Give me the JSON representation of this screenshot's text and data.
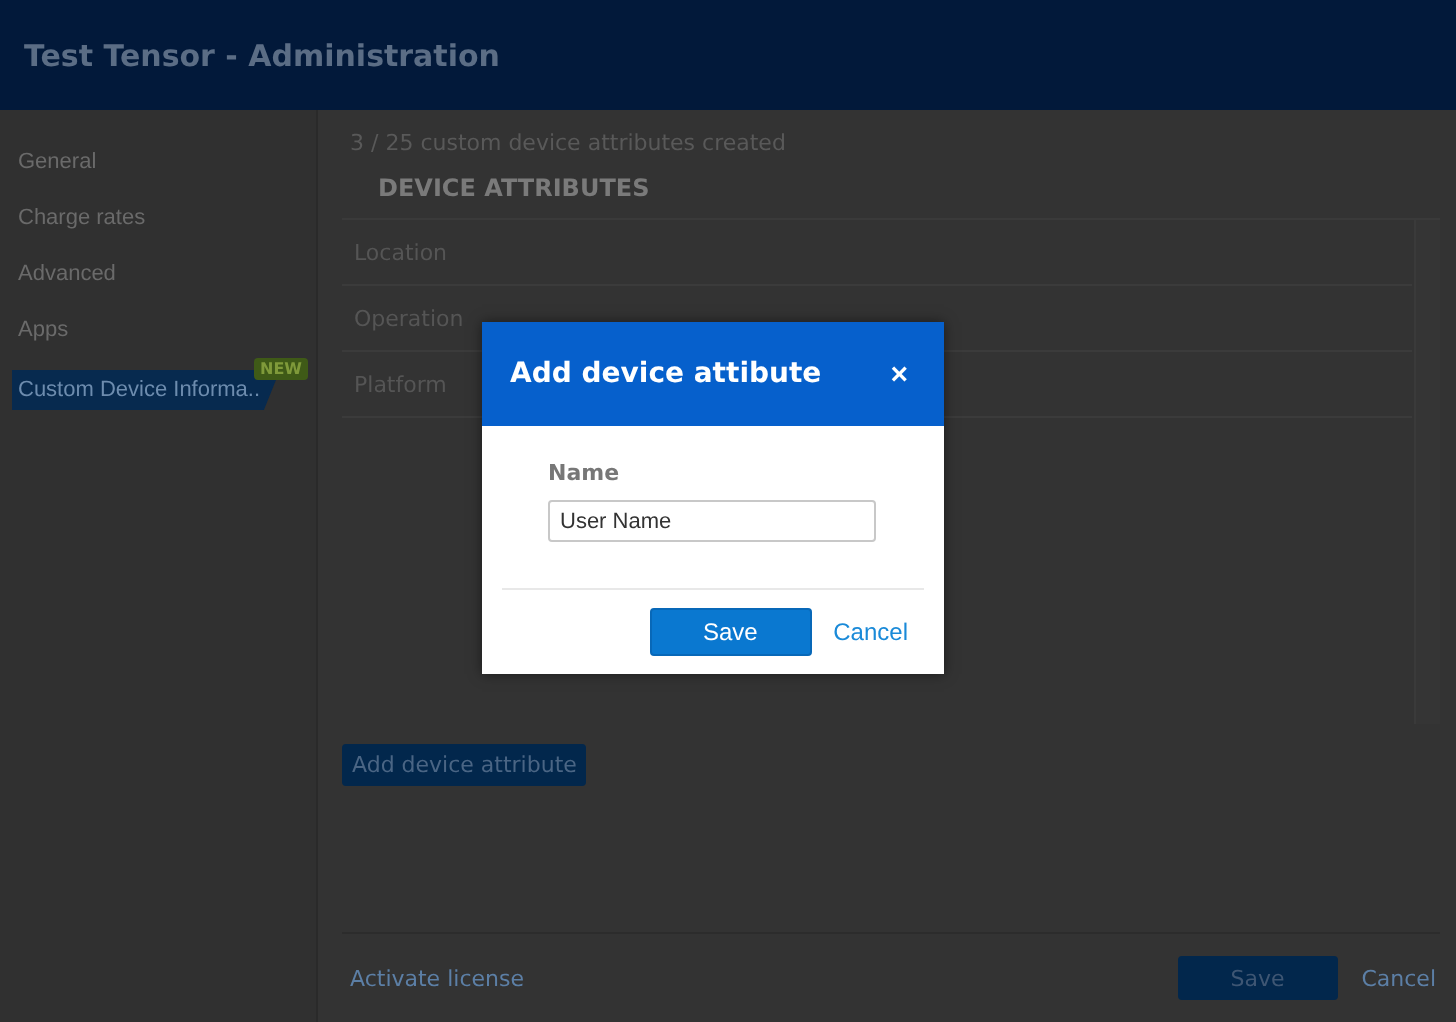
{
  "window": {
    "title": "Test Tensor - Administration"
  },
  "sidebar": {
    "items": [
      {
        "label": "General",
        "selected": false
      },
      {
        "label": "Charge rates",
        "selected": false
      },
      {
        "label": "Advanced",
        "selected": false
      },
      {
        "label": "Apps",
        "selected": false
      },
      {
        "label": "Custom Device Informa..",
        "selected": true,
        "badge": "NEW"
      }
    ]
  },
  "main": {
    "summary": "3 / 25 custom device attributes created",
    "section_title": "DEVICE ATTRIBUTES",
    "attributes": [
      "Location",
      "Operation",
      "Platform"
    ],
    "add_button": "Add device attribute",
    "footer": {
      "link": "Activate license",
      "save": "Save",
      "cancel": "Cancel"
    }
  },
  "dialog": {
    "title": "Add device attibute",
    "close": "×",
    "field_label": "Name",
    "field_value": "User Name",
    "save": "Save",
    "cancel": "Cancel"
  }
}
